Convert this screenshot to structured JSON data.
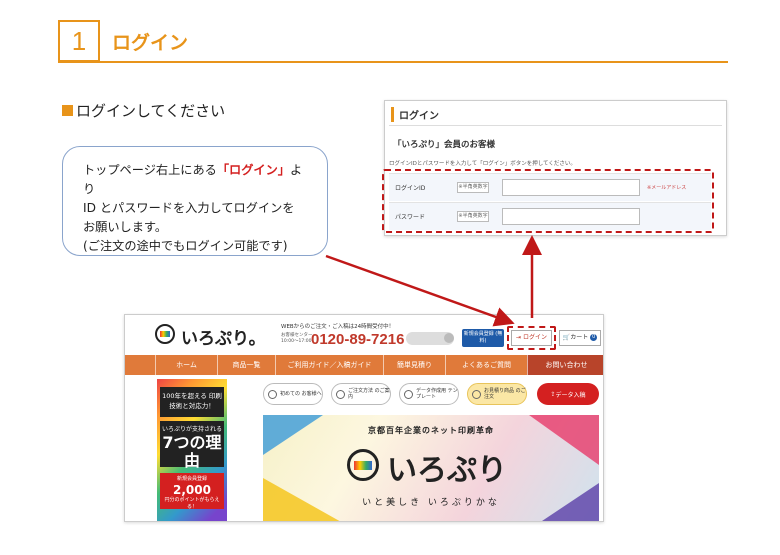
{
  "step": {
    "number": "1",
    "title": "ログイン"
  },
  "section": {
    "heading": "ログインしてください"
  },
  "callout": {
    "line1_pre": "トップページ右上にある",
    "line1_hl": "「ログイン」",
    "line1_post": "より",
    "line2": "ID とパスワードを入力してログインを",
    "line3": "お願いします。",
    "line4": "(ご注文の途中でもログイン可能です)"
  },
  "login_panel": {
    "title": "ログイン",
    "subtitle": "「いろぷり」会員のお客様",
    "description": "ログインIDとパスワードを入力して「ログイン」ボタンを押してください。",
    "rows": [
      {
        "label": "ログインID",
        "badge": "※半角英数字",
        "note": "※メールアドレス"
      },
      {
        "label": "パスワード",
        "badge": "※半角英数字",
        "note": ""
      }
    ]
  },
  "site": {
    "logo": "いろぷり。",
    "header_note": "WEBからのご注文・ご入稿は24時間受付中！",
    "center_label": "お客様センター 10:00〜17:00",
    "phone": "0120-89-7216",
    "register_button": "新規会員登録 (無料)",
    "login_button": "ログイン",
    "cart_button": "カート",
    "cart_count": "0",
    "nav": [
      "ホーム",
      "商品一覧",
      "ご利用ガイド／入稿ガイド",
      "簡単見積り",
      "よくあるご質問",
      "お問い合わせ"
    ],
    "left_banner": {
      "box1": "100年を超える 印刷技術と対応力！",
      "box2_pre": "いろぷりが支持される",
      "box2_big": "7つの理由",
      "box3_pre": "新規会員登録",
      "box3_big": "2,000",
      "box3_post": "円分のポイントがもらえる！"
    },
    "icon_buttons": [
      {
        "label": "初めての お客様へ"
      },
      {
        "label": "ご注文方法 のご案内"
      },
      {
        "label": "データ作成用 テンプレート"
      },
      {
        "label": "お見積り商品 のご注文"
      }
    ],
    "data_button": "データ入稿",
    "hero": {
      "top": "京都百年企業のネット印刷革命",
      "name": "いろぷり",
      "tagline": "いと美しき いろぷりかな"
    }
  },
  "colors": {
    "accent": "#e8941a",
    "red": "#c01818",
    "nav": "#e07a3a",
    "blue": "#1e5aa8"
  }
}
